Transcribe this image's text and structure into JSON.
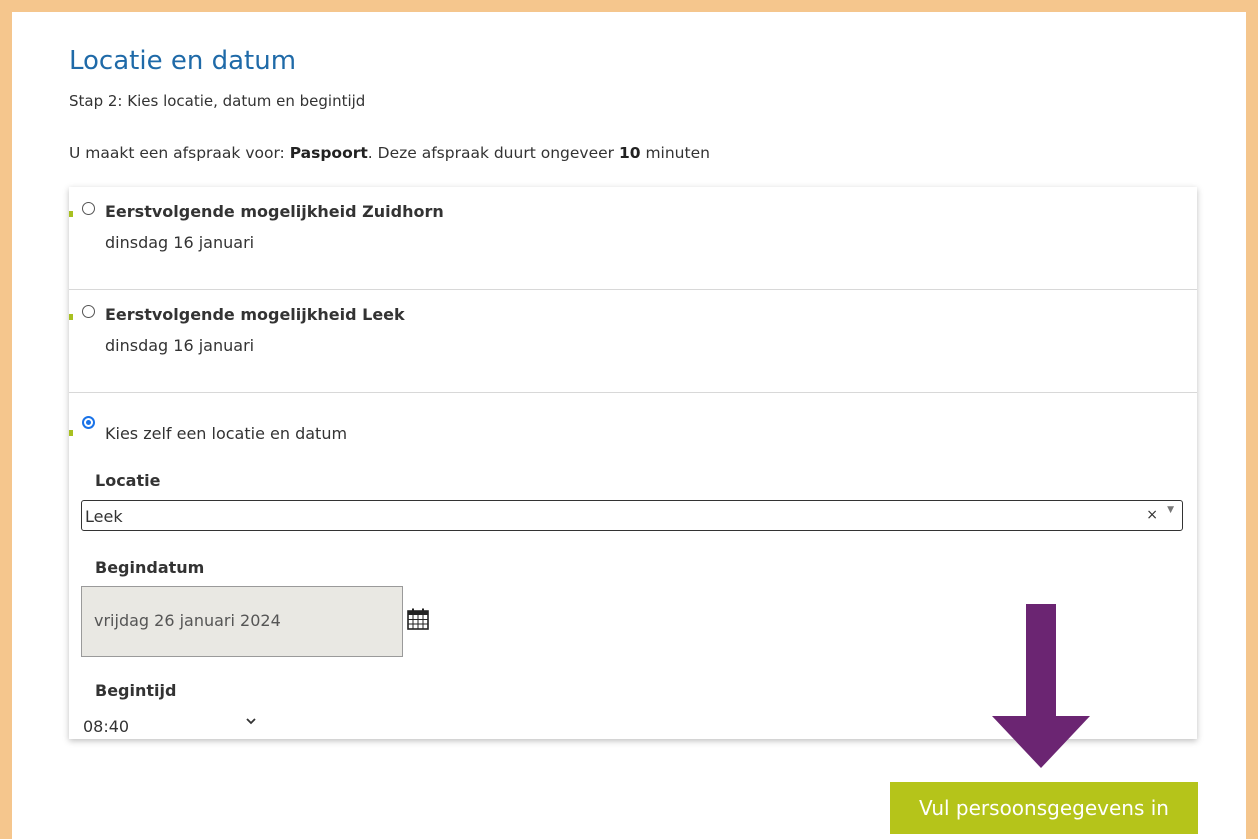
{
  "header": {
    "title": "Locatie en datum",
    "step": "Stap 2: Kies locatie, datum en begintijd"
  },
  "intro": {
    "prefix": "U maakt een afspraak voor: ",
    "product": "Paspoort",
    "middle": ". Deze afspraak duurt ongeveer ",
    "duration": "10",
    "suffix": " minuten"
  },
  "options": [
    {
      "title": "Eerstvolgende mogelijkheid Zuidhorn",
      "date": "dinsdag 16 januari",
      "selected": false
    },
    {
      "title": "Eerstvolgende mogelijkheid Leek",
      "date": "dinsdag 16 januari",
      "selected": false
    },
    {
      "label": "Kies zelf een locatie en datum",
      "selected": true
    }
  ],
  "form": {
    "location_label": "Locatie",
    "location_value": "Leek",
    "location_clear": "×",
    "start_date_label": "Begindatum",
    "start_date_value": "vrijdag 26 januari 2024",
    "start_time_label": "Begintijd",
    "start_time_value": "08:40"
  },
  "icons": {
    "calendar": "calendar-icon",
    "chevron": "chevron-down-icon",
    "arrow": "arrow-down-icon"
  },
  "submit_button": "Vul persoonsgegevens in",
  "colors": {
    "border": "#f5c68d",
    "title": "#1f6aa8",
    "button": "#b5c41a",
    "arrow": "#6b2572",
    "radio_checked": "#1a73e8"
  }
}
